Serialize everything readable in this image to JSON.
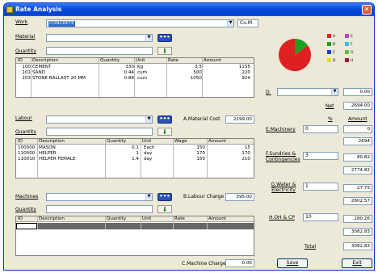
{
  "window": {
    "title": "Rate Analysis",
    "close": "✕"
  },
  "work": {
    "label": "Work",
    "value": "CONCRETE",
    "unit": "Cu.M."
  },
  "material": {
    "label": "Material",
    "quantity_label": "Quantity",
    "dots": "•••"
  },
  "material_table": {
    "headers": [
      "ID",
      "Description",
      "Quantity",
      "Unit",
      "Rate",
      "Amount"
    ],
    "rows": [
      [
        "100",
        "CEMENT",
        "330",
        "Kg",
        "3.5",
        "1155"
      ],
      [
        "101",
        "SAND",
        "0.44",
        "cum",
        "500",
        "220"
      ],
      [
        "103",
        "STONE BALLAST 20 MM",
        "0.88",
        "cum",
        "1050",
        "924"
      ]
    ]
  },
  "labour": {
    "label": "Labour",
    "quantity_label": "Quantity",
    "dots": "•••"
  },
  "labour_table": {
    "headers": [
      "ID",
      "Description",
      "Quantity",
      "Unit",
      "Wage",
      "Amount"
    ],
    "rows": [
      [
        "100000",
        "MASON",
        "0.1",
        "Each",
        "150",
        "15"
      ],
      [
        "110000",
        "HELPER",
        "1",
        "day",
        "170",
        "170"
      ],
      [
        "110010",
        "HELPER FEMALE",
        "1.4",
        "day",
        "150",
        "210"
      ]
    ]
  },
  "machines": {
    "label": "Machines",
    "quantity_label": "Quantity",
    "dots": "•••"
  },
  "machine_table": {
    "headers": [
      "ID",
      "Description",
      "Quantity",
      "Unit",
      "Rate",
      "Amount"
    ]
  },
  "costs": {
    "a_label": "A.Material Cost",
    "a_value": "2299.00",
    "b_label": "B.Labour Charge",
    "b_value": "395.00",
    "c_label": "C.Machine Charge",
    "c_value": "0.00"
  },
  "legend": [
    "A",
    "E",
    "B",
    "F",
    "C",
    "G",
    "D",
    "H"
  ],
  "legend_colors": [
    "#e02020",
    "#c040c0",
    "#20a020",
    "#30c0e0",
    "#2040d0",
    "#60c040",
    "#e0e020",
    "#a02030"
  ],
  "right": {
    "d_label": "D.",
    "d_value": "0.00",
    "net_label": "Net",
    "net_value": "2694.00",
    "pct_label": "%",
    "amount_label": "Amount",
    "e_label": "E.Machinery",
    "e_pct": "0",
    "e_amount": "0",
    "sub1": "2694",
    "f_label": "F.Sundries & Contingencies",
    "f_pct": "3",
    "f_amount": "80.82",
    "sub2": "2774.82",
    "g_label": "G.Water & Electricity",
    "g_pct": "1",
    "g_amount": "27.75",
    "sub3": "2802.57",
    "h_label": "H.OH & CP",
    "h_pct": "10",
    "h_amount": "280.26",
    "sub4": "3082.83",
    "total_label": "Total",
    "total_value": "3082.83",
    "save": "Save",
    "exit": "Exit"
  },
  "pie": {
    "A": 85.3,
    "B": 14.7
  }
}
